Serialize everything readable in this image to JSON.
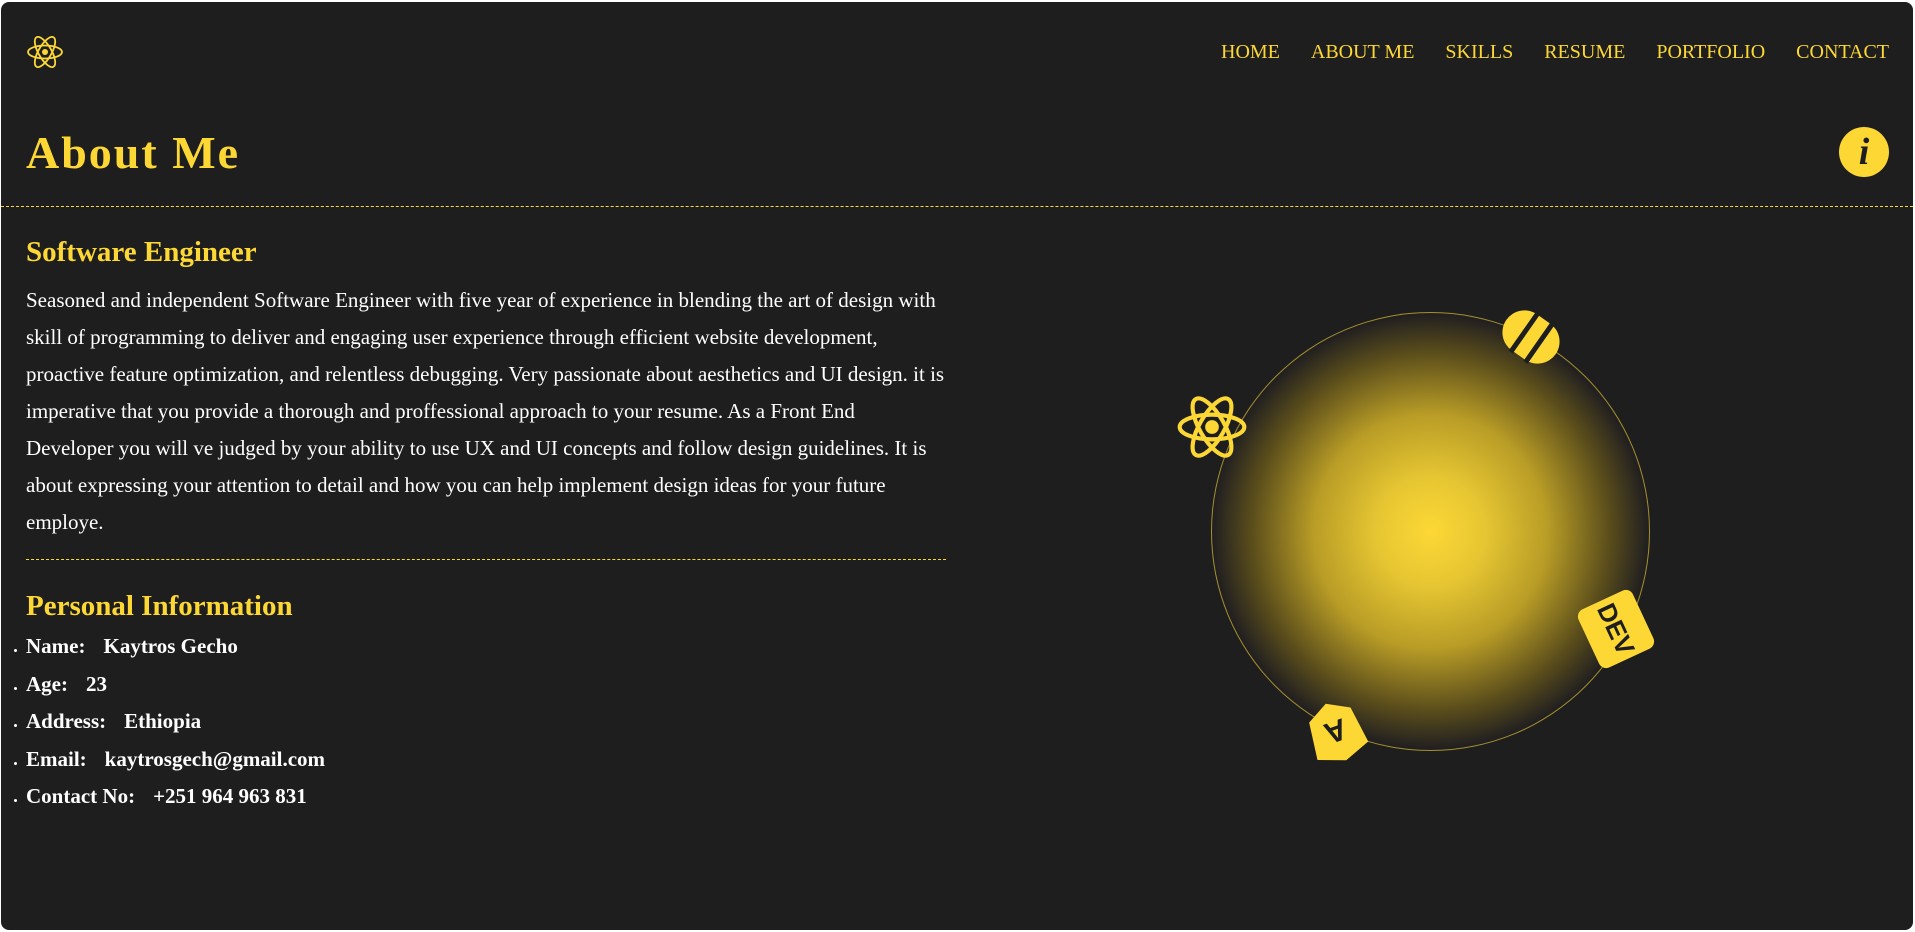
{
  "nav": {
    "items": [
      {
        "id": "home",
        "label": "HOME"
      },
      {
        "id": "about",
        "label": "ABOUT ME"
      },
      {
        "id": "skills",
        "label": "SKILLS"
      },
      {
        "id": "resume",
        "label": "RESUME"
      },
      {
        "id": "portfolio",
        "label": "PORTFOLIO"
      },
      {
        "id": "contact",
        "label": "CONTACT"
      }
    ]
  },
  "header": {
    "title": "About Me",
    "info_icon_label": "i"
  },
  "about": {
    "role_title": "Software Engineer",
    "bio": "Seasoned and independent Software Engineer with five year of experience in blending the art of design with skill of programming to deliver and engaging user experience through efficient website development, proactive feature optimization, and relentless debugging. Very passionate about aesthetics and UI design. it is imperative that you provide a thorough and proffessional approach to your resume. As a Front End Developer you will ve judged by your ability to use UX and UI concepts and follow design guidelines. It is about expressing your attention to detail and how you can help implement design ideas for your future employe."
  },
  "personal": {
    "title": "Personal Information",
    "items": [
      {
        "key": "Name:",
        "value": "Kaytros Gecho"
      },
      {
        "key": "Age:",
        "value": "23"
      },
      {
        "key": "Address:",
        "value": "Ethiopia"
      },
      {
        "key": "Email:",
        "value": "kaytrosgech@gmail.com"
      },
      {
        "key": "Contact No:",
        "value": "+251 964 963 831"
      }
    ]
  },
  "orbit": {
    "icons": [
      "react-icon",
      "database-icon",
      "dev-icon",
      "angular-icon"
    ],
    "dev_badge_text": "DEV",
    "angular_badge_text": "A"
  },
  "colors": {
    "accent": "#fdd835",
    "background": "#1e1e1e",
    "text": "#ffffff"
  }
}
